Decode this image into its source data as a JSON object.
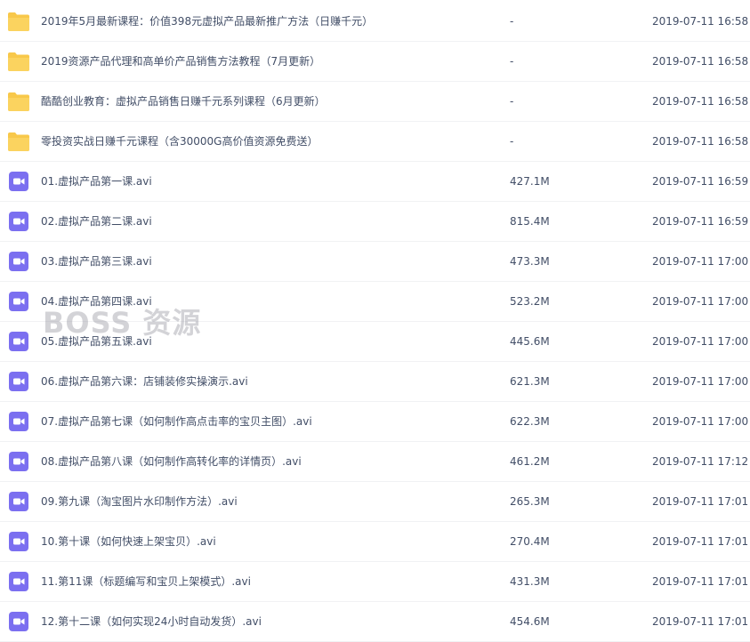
{
  "watermark": "BOSS 资源",
  "colors": {
    "folder": "#f8c84a",
    "video": "#7b6ff0",
    "text": "#424e67",
    "divider": "#f1f2f4"
  },
  "files": [
    {
      "name": "2019年5月最新课程：价值398元虚拟产品最新推广方法（日赚千元）",
      "size": "-",
      "date": "2019-07-11 16:58",
      "icon": "folder-icon"
    },
    {
      "name": "2019资源产品代理和高单价产品销售方法教程（7月更新）",
      "size": "-",
      "date": "2019-07-11 16:58",
      "icon": "folder-icon"
    },
    {
      "name": "酷酷创业教育：虚拟产品销售日赚千元系列课程（6月更新）",
      "size": "-",
      "date": "2019-07-11 16:58",
      "icon": "folder-icon"
    },
    {
      "name": "零投资实战日赚千元课程（含30000G高价值资源免费送）",
      "size": "-",
      "date": "2019-07-11 16:58",
      "icon": "folder-icon"
    },
    {
      "name": "01.虚拟产品第一课.avi",
      "size": "427.1M",
      "date": "2019-07-11 16:59",
      "icon": "video-icon"
    },
    {
      "name": "02.虚拟产品第二课.avi",
      "size": "815.4M",
      "date": "2019-07-11 16:59",
      "icon": "video-icon"
    },
    {
      "name": "03.虚拟产品第三课.avi",
      "size": "473.3M",
      "date": "2019-07-11 17:00",
      "icon": "video-icon"
    },
    {
      "name": "04.虚拟产品第四课.avi",
      "size": "523.2M",
      "date": "2019-07-11 17:00",
      "icon": "video-icon"
    },
    {
      "name": "05.虚拟产品第五课.avi",
      "size": "445.6M",
      "date": "2019-07-11 17:00",
      "icon": "video-icon"
    },
    {
      "name": "06.虚拟产品第六课：店铺装修实操演示.avi",
      "size": "621.3M",
      "date": "2019-07-11 17:00",
      "icon": "video-icon"
    },
    {
      "name": "07.虚拟产品第七课（如何制作高点击率的宝贝主图）.avi",
      "size": "622.3M",
      "date": "2019-07-11 17:00",
      "icon": "video-icon"
    },
    {
      "name": "08.虚拟产品第八课（如何制作高转化率的详情页）.avi",
      "size": "461.2M",
      "date": "2019-07-11 17:12",
      "icon": "video-icon"
    },
    {
      "name": "09.第九课（淘宝图片水印制作方法）.avi",
      "size": "265.3M",
      "date": "2019-07-11 17:01",
      "icon": "video-icon"
    },
    {
      "name": "10.第十课（如何快速上架宝贝）.avi",
      "size": "270.4M",
      "date": "2019-07-11 17:01",
      "icon": "video-icon"
    },
    {
      "name": "11.第11课（标题编写和宝贝上架模式）.avi",
      "size": "431.3M",
      "date": "2019-07-11 17:01",
      "icon": "video-icon"
    },
    {
      "name": "12.第十二课（如何实现24小时自动发货）.avi",
      "size": "454.6M",
      "date": "2019-07-11 17:01",
      "icon": "video-icon"
    }
  ]
}
